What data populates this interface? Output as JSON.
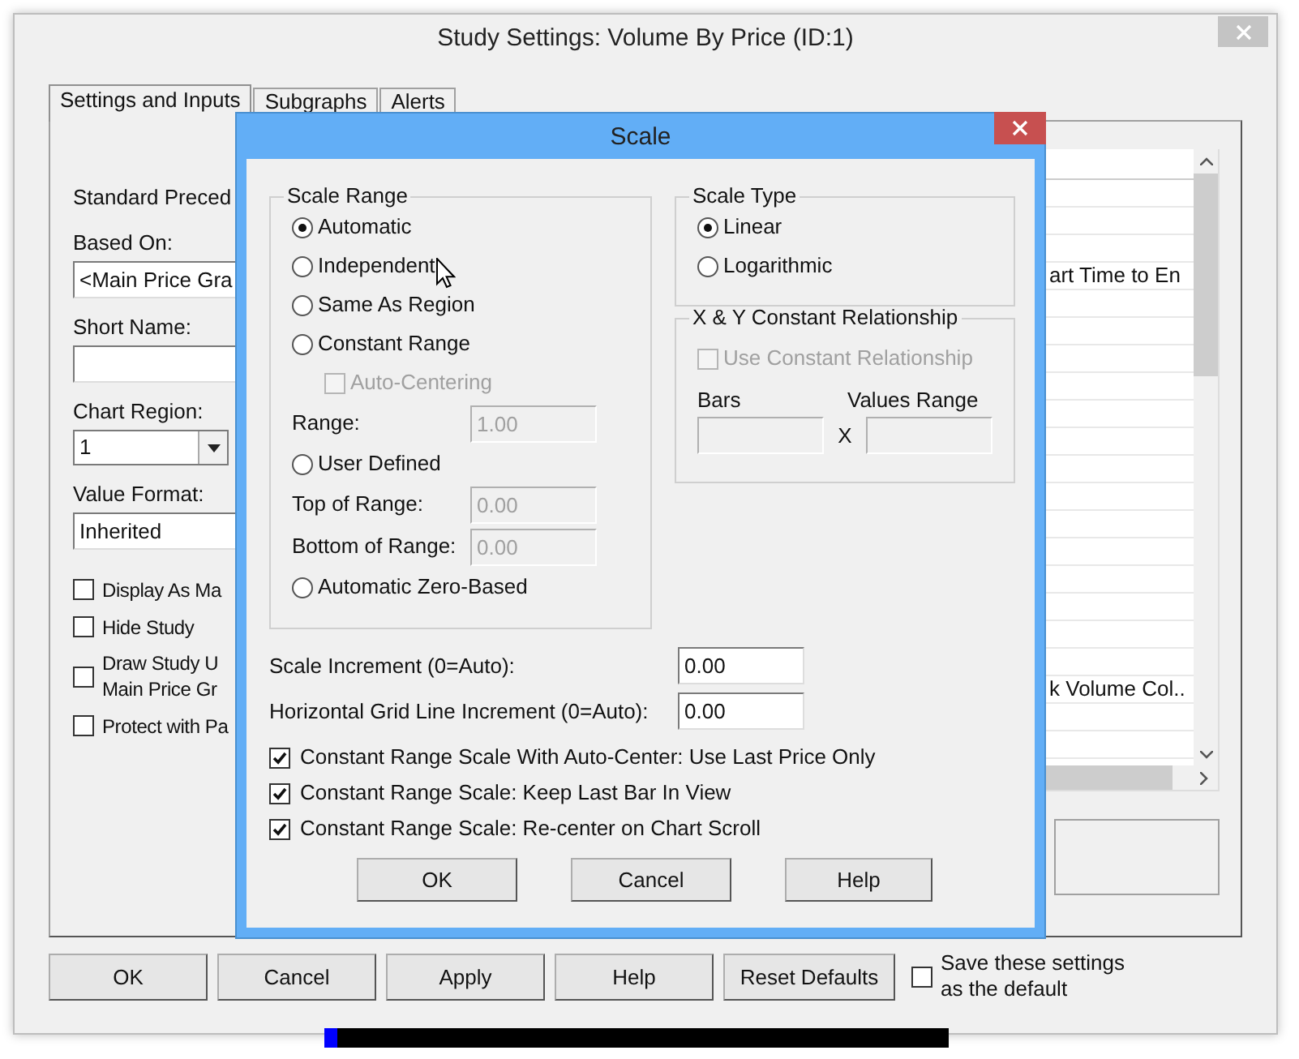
{
  "window": {
    "title": "Study Settings: Volume By Price (ID:1)"
  },
  "tabs": [
    {
      "label": "Settings and Inputs",
      "selected": true
    },
    {
      "label": "Subgraphs",
      "selected": false
    },
    {
      "label": "Alerts",
      "selected": false
    }
  ],
  "form": [
    {
      "kind": "heading",
      "text": "Standard Preced"
    },
    {
      "kind": "label",
      "text": "Based On:"
    },
    {
      "kind": "field",
      "value": "<Main Price Gra"
    },
    {
      "kind": "label",
      "text": "Short Name:"
    },
    {
      "kind": "field"
    },
    {
      "kind": "label",
      "text": "Chart Region:"
    },
    {
      "kind": "select",
      "value": "1"
    },
    {
      "kind": "label",
      "text": "Value Format:"
    },
    {
      "kind": "field",
      "value": "Inherited"
    },
    {
      "kind": "checkbox",
      "lines": [
        "Display As Ma"
      ],
      "checked": false
    },
    {
      "kind": "checkbox",
      "lines": [
        "Hide Study"
      ],
      "checked": false
    },
    {
      "kind": "checkbox",
      "lines": [
        "Draw Study U",
        "Main Price Gr"
      ],
      "checked": false
    },
    {
      "kind": "checkbox",
      "lines": [
        "Protect with Pa"
      ],
      "checked": false
    }
  ],
  "list": {
    "texts": [
      "art Time to En",
      "k Volume Col.."
    ]
  },
  "buttons": [
    "OK",
    "Cancel",
    "Apply",
    "Help",
    "Reset Defaults"
  ],
  "save_default": {
    "lines": [
      "Save these settings",
      "as the default"
    ],
    "checked": false
  },
  "scale_dialog": {
    "title": "Scale",
    "scale_range": {
      "legend": "Scale Range",
      "items": [
        {
          "kind": "radio",
          "label": "Automatic",
          "selected": true
        },
        {
          "kind": "radio",
          "label": "Independent",
          "selected": false
        },
        {
          "kind": "radio",
          "label": "Same As Region",
          "selected": false
        },
        {
          "kind": "radio",
          "label": "Constant Range",
          "selected": false
        },
        {
          "kind": "checkbox",
          "label": "Auto-Centering",
          "checked": false,
          "disabled": true
        },
        {
          "kind": "field",
          "label": "Range:",
          "value": "1.00",
          "disabled": true
        },
        {
          "kind": "radio",
          "label": "User Defined",
          "selected": false
        },
        {
          "kind": "field",
          "label": "Top of Range:",
          "value": "0.00",
          "disabled": true
        },
        {
          "kind": "field",
          "label": "Bottom of Range:",
          "value": "0.00",
          "disabled": true
        },
        {
          "kind": "radio",
          "label": "Automatic Zero-Based",
          "selected": false
        }
      ]
    },
    "scale_type": {
      "legend": "Scale Type",
      "options": [
        {
          "label": "Linear",
          "selected": true
        },
        {
          "label": "Logarithmic",
          "selected": false
        }
      ]
    },
    "xy": {
      "legend": "X & Y Constant Relationship",
      "checkbox": {
        "label": "Use Constant Relationship",
        "checked": false,
        "disabled": true
      },
      "bars_label": "Bars",
      "separator": "X",
      "values_label": "Values Range"
    },
    "increments": [
      {
        "label": "Scale Increment (0=Auto):",
        "value": "0.00"
      },
      {
        "label": "Horizontal Grid Line Increment (0=Auto):",
        "value": "0.00"
      }
    ],
    "options": [
      {
        "label": "Constant Range Scale With Auto-Center: Use Last Price Only",
        "checked": true
      },
      {
        "label": "Constant Range Scale: Keep Last Bar In View",
        "checked": true
      },
      {
        "label": "Constant Range Scale: Re-center on Chart Scroll",
        "checked": true
      }
    ],
    "buttons": [
      "OK",
      "Cancel",
      "Help"
    ]
  }
}
